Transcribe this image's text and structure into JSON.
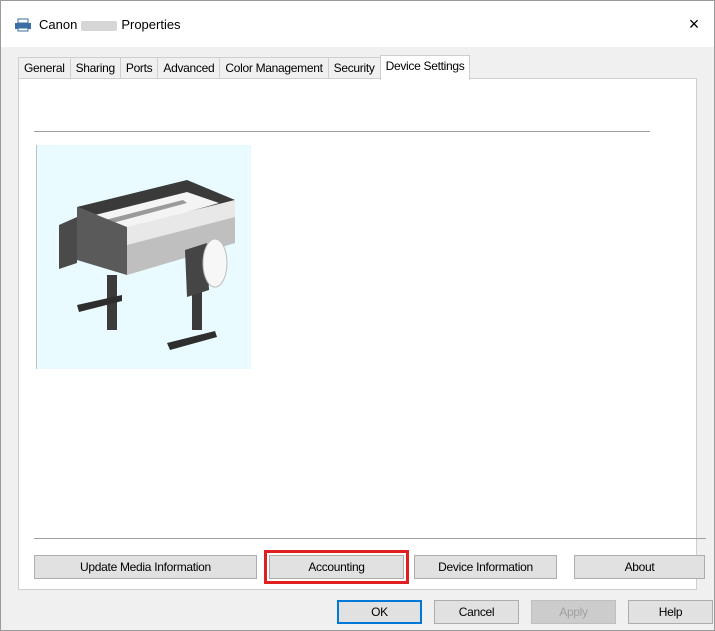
{
  "window": {
    "title_prefix": "Canon",
    "title_suffix": "Properties",
    "close_glyph": "×"
  },
  "tabs": [
    {
      "label": "General"
    },
    {
      "label": "Sharing"
    },
    {
      "label": "Ports"
    },
    {
      "label": "Advanced"
    },
    {
      "label": "Color Management"
    },
    {
      "label": "Security"
    },
    {
      "label": "Device Settings",
      "active": true
    }
  ],
  "device_buttons": {
    "update_media": "Update Media Information",
    "accounting": "Accounting",
    "device_info": "Device Information",
    "about": "About"
  },
  "dialog_buttons": {
    "ok": "OK",
    "cancel": "Cancel",
    "apply": "Apply",
    "help": "Help"
  },
  "colors": {
    "highlight": "#e02020",
    "image_background": "#e9fbff"
  },
  "icons": [
    "printer-icon",
    "close-icon"
  ],
  "images": [
    "printer-illustration"
  ]
}
